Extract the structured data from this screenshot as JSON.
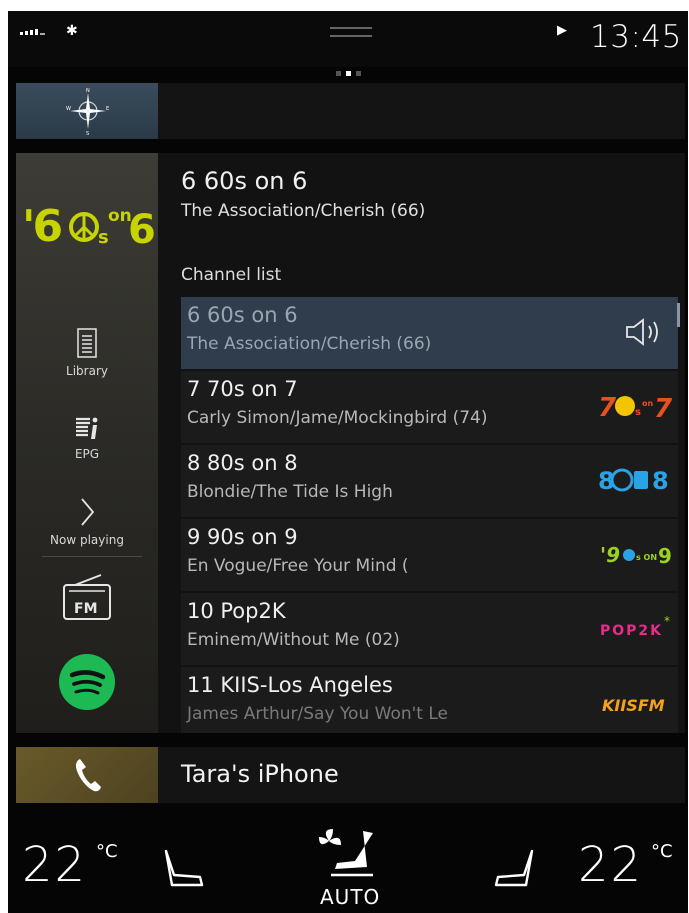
{
  "status_bar": {
    "time": "13:45",
    "icons": [
      "signal-icon",
      "bluetooth-icon",
      "play-icon"
    ]
  },
  "media": {
    "station_logo_text": "'60s on 6",
    "now_playing": {
      "title": "6 60s on 6",
      "subtitle": "The Association/Cherish (66)"
    },
    "side_menu": [
      {
        "label": "Library",
        "icon": "library-icon"
      },
      {
        "label": "EPG",
        "icon": "epg-icon"
      },
      {
        "label": "Now playing",
        "icon": "chevron-right-icon"
      }
    ],
    "sources": [
      "fm-radio-icon",
      "spotify-icon"
    ],
    "channel_list_header": "Channel list",
    "channels": [
      {
        "title": "6 60s on 6",
        "subtitle": "The Association/Cherish (66)",
        "logo": "speaker-icon",
        "selected": true
      },
      {
        "title": "7 70s on 7",
        "subtitle": "Carly Simon/Jame/Mockingbird (74)",
        "logo": "70s-on-7-logo"
      },
      {
        "title": "8 80s on 8",
        "subtitle": "Blondie/The Tide Is High",
        "logo": "80s-on-8-logo"
      },
      {
        "title": "9 90s on 9",
        "subtitle": "En Vogue/Free Your Mind (",
        "logo": "90s-on-9-logo"
      },
      {
        "title": "10 Pop2K",
        "subtitle": "Eminem/Without Me (02)",
        "logo": "pop2k-logo"
      },
      {
        "title": "11 KIIS-Los Angeles",
        "subtitle": "James Arthur/Say You Won't Le",
        "logo": "kiis-fm-logo"
      }
    ],
    "logo_texts": {
      "c7": "70s7",
      "c8": "80s8",
      "c9": "'90s9",
      "c10": "POP2K",
      "c11": "KIISFM"
    }
  },
  "phone": {
    "device_name": "Tara's iPhone"
  },
  "climate": {
    "left_temp": "22",
    "left_unit": "°C",
    "right_temp": "22",
    "right_unit": "°C",
    "fan_mode": "AUTO"
  },
  "colors": {
    "selected_row": "#2f3d4d",
    "spotify": "#1db954",
    "logo_yellow_green": "#c8d400"
  }
}
